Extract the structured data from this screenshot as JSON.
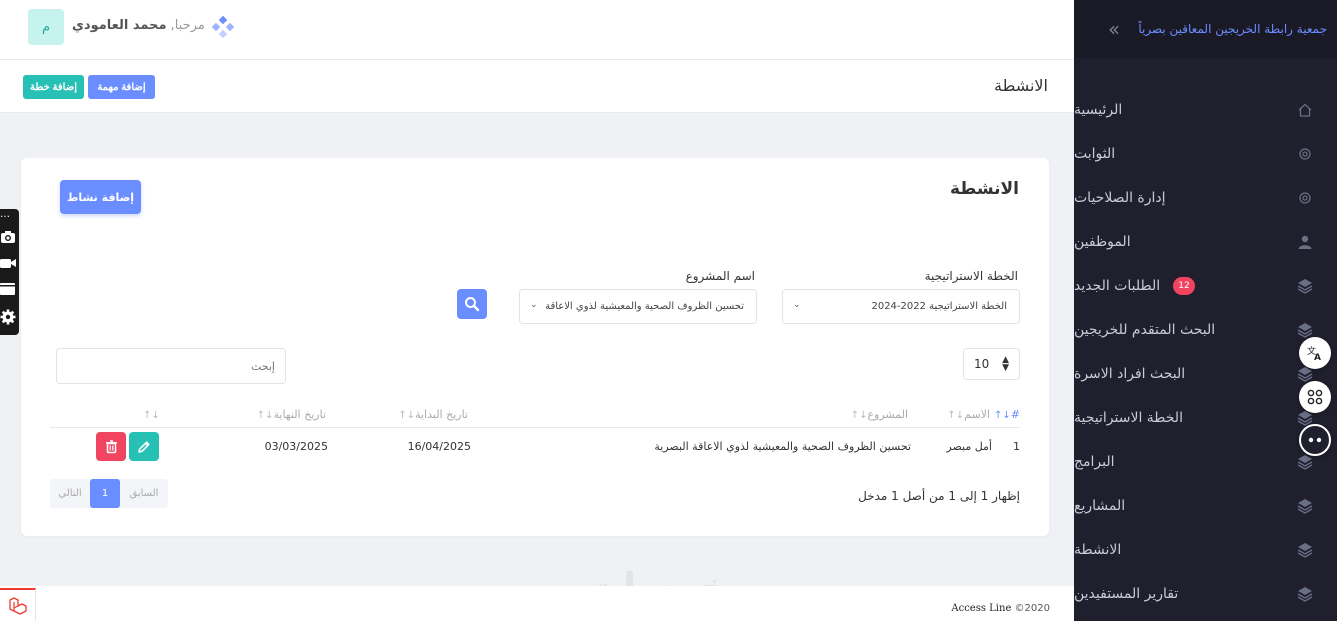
{
  "sidebar": {
    "brand": "جمعية رابطة الخريجين المعاقين بصرياً",
    "items": [
      {
        "label": "الرئيسية",
        "icon": "home-icon"
      },
      {
        "label": "الثوابت",
        "icon": "gear-icon"
      },
      {
        "label": "إدارة الصلاحيات",
        "icon": "gear-icon"
      },
      {
        "label": "الموظفين",
        "icon": "user-icon"
      },
      {
        "label": "الطلبات الجديد",
        "icon": "layers-icon",
        "badge": "12"
      },
      {
        "label": "البحث المتقدم للخريجين",
        "icon": "layers-icon"
      },
      {
        "label": "البحث افراد الاسرة",
        "icon": "layers-icon"
      },
      {
        "label": "الخطة الاستراتيجية",
        "icon": "layers-icon"
      },
      {
        "label": "البرامج",
        "icon": "layers-icon"
      },
      {
        "label": "المشاريع",
        "icon": "layers-icon"
      },
      {
        "label": "الانشطة",
        "icon": "layers-icon"
      },
      {
        "label": "تقارير المستفيدين",
        "icon": "layers-icon"
      }
    ]
  },
  "header": {
    "avatar_letter": "م",
    "welcome": "مرحبا,",
    "user_name": "محمد العامودي"
  },
  "subheader": {
    "title": "الانشطة",
    "add_task": "إضافة مهمة",
    "add_plan": "إضافة خطة"
  },
  "card": {
    "title": "الانشطة",
    "add_activity": "إضافة نشاط",
    "filters": {
      "plan_label": "الخطة الاستراتيجية",
      "plan_value": "الخطة الاستراتيجية 2022-2024",
      "project_label": "اسم المشروع",
      "project_value": "تحسين الظروف الصحية والمعيشية لذوي الاعاقة"
    },
    "page_length": "10",
    "search_placeholder": "إبحث",
    "columns": [
      "#",
      "الاسم",
      "المشروع",
      "تاريخ البداية",
      "تاريخ النهاية"
    ],
    "rows": [
      {
        "num": "1",
        "name": "أمل مبصر",
        "project": "تحسين الظروف الصحية والمعيشية لذوي الاعاقة البصرية",
        "start": "16/04/2025",
        "end": "03/03/2025"
      }
    ],
    "info": "إظهار 1 إلى 1 من أصل 1 مدخل",
    "pagination": {
      "prev": "السابق",
      "current": "1",
      "next": "التالي"
    }
  },
  "footer": {
    "copyright": "©2020",
    "brand": "Access Line",
    "watermark": "خمسات"
  },
  "colors": {
    "primary": "#6a8dff",
    "teal": "#27c0b4",
    "danger": "#f04461",
    "sidebar_bg": "#1f1f2d"
  }
}
